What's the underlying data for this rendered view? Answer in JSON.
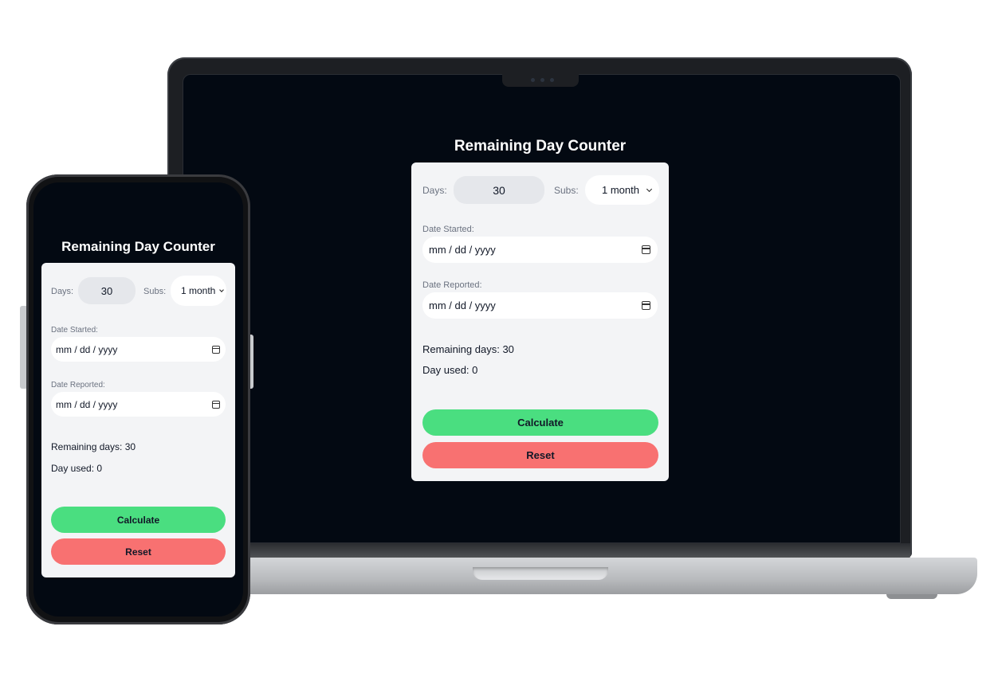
{
  "app": {
    "title": "Remaining Day Counter",
    "days_label": "Days:",
    "days_value": "30",
    "subs_label": "Subs:",
    "subs_selected": "1 month",
    "date_started_label": "Date Started:",
    "date_started_placeholder": "mm / dd / yyyy",
    "date_reported_label": "Date Reported:",
    "date_reported_placeholder": "mm / dd / yyyy",
    "remaining_days_text": "Remaining days: 30",
    "day_used_text": "Day used: 0",
    "calculate_label": "Calculate",
    "reset_label": "Reset"
  },
  "colors": {
    "screen_bg": "#030912",
    "card_bg": "#f3f4f6",
    "calculate_bg": "#4ade80",
    "reset_bg": "#f87171"
  },
  "icons": {
    "date_picker": "calendar-icon",
    "select_arrow": "chevron-down-icon"
  }
}
